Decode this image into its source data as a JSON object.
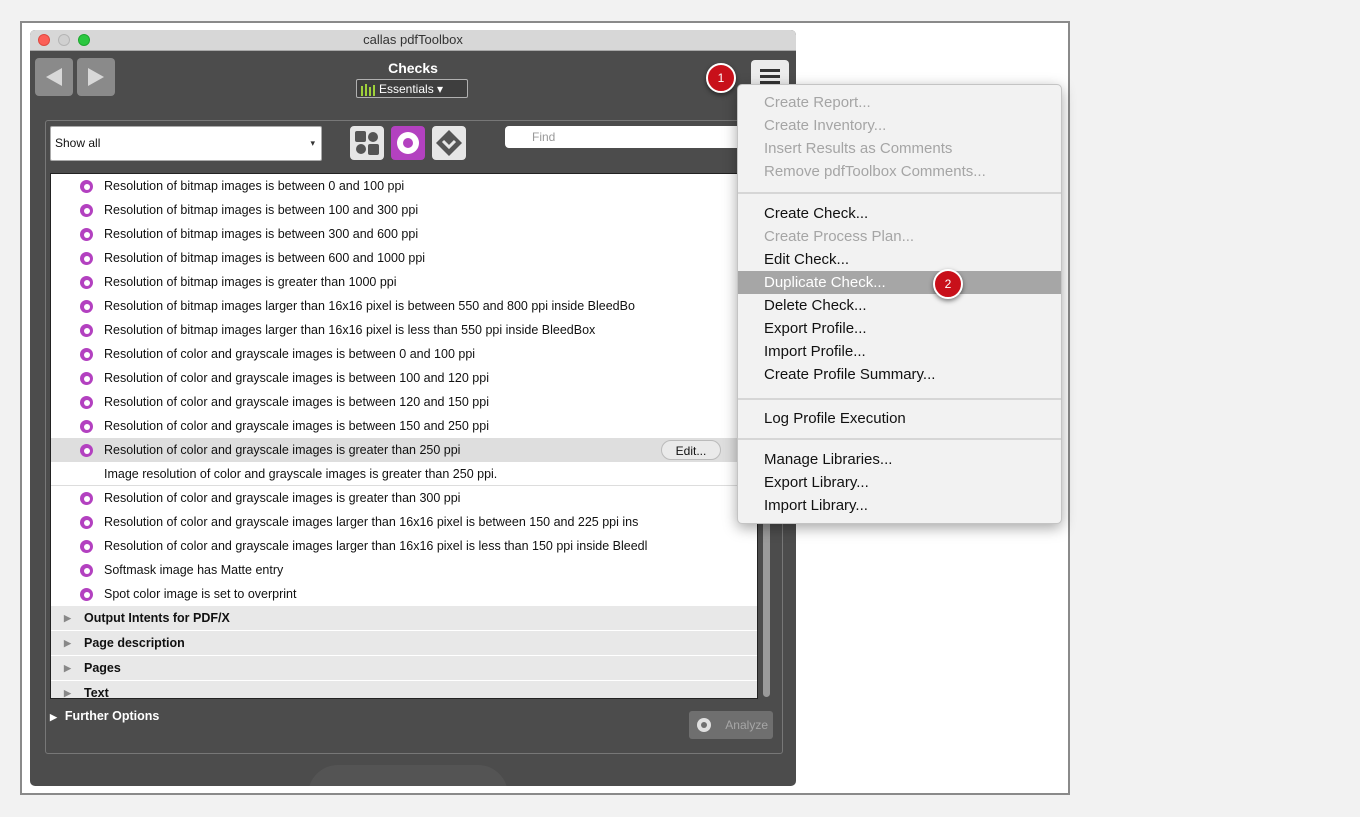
{
  "window": {
    "title": "callas pdfToolbox"
  },
  "header": {
    "title": "Checks",
    "library": "Essentials"
  },
  "filter": {
    "selected": "Show all",
    "search_placeholder": "Find"
  },
  "checks": [
    "Resolution of bitmap images is between 0 and 100 ppi",
    "Resolution of bitmap images is between 100 and 300 ppi",
    "Resolution of bitmap images is between 300 and 600 ppi",
    "Resolution of bitmap images is between 600 and 1000 ppi",
    "Resolution of bitmap images is greater than 1000 ppi",
    "Resolution of bitmap images larger than 16x16 pixel is between 550 and 800 ppi inside BleedBo",
    "Resolution of bitmap images larger than 16x16 pixel is less than 550 ppi inside BleedBox",
    "Resolution of color and grayscale images is between 0 and 100 ppi",
    "Resolution of color and grayscale images is between 100 and 120 ppi",
    "Resolution of color and grayscale images is between 120 and 150 ppi",
    "Resolution of color and grayscale images is between 150 and 250 ppi"
  ],
  "selected_check": {
    "title": "Resolution of color and grayscale images is greater than 250 ppi",
    "description": "Image resolution of color and grayscale images is greater than 250 ppi.",
    "edit_label": "Edit..."
  },
  "checks_after": [
    "Resolution of color and grayscale images is greater than 300 ppi",
    "Resolution of color and grayscale images larger than 16x16 pixel is between 150 and 225 ppi ins",
    "Resolution of color and grayscale images larger than 16x16 pixel is less than 150 ppi inside Bleedl",
    "Softmask image has Matte entry",
    "Spot color image is set to overprint"
  ],
  "groups": [
    "Output Intents for PDF/X",
    "Page description",
    "Pages",
    "Text"
  ],
  "footer": {
    "further_options": "Further Options",
    "analyze": "Analyze"
  },
  "menu": {
    "items": [
      "Create Report...",
      "Create Inventory...",
      "Insert Results as Comments",
      "Remove pdfToolbox Comments...",
      "Create Check...",
      "Create Process Plan...",
      "Edit Check...",
      "Duplicate Check...",
      "Delete Check...",
      "Export Profile...",
      "Import Profile...",
      "Create Profile Summary...",
      "Log Profile Execution",
      "Manage Libraries...",
      "Export Library...",
      "Import Library..."
    ]
  },
  "callouts": {
    "first": "1",
    "second": "2"
  },
  "colors": {
    "check_icon": "#b341c0",
    "callout": "#c8101a",
    "highlight": "#a6a6a6"
  }
}
